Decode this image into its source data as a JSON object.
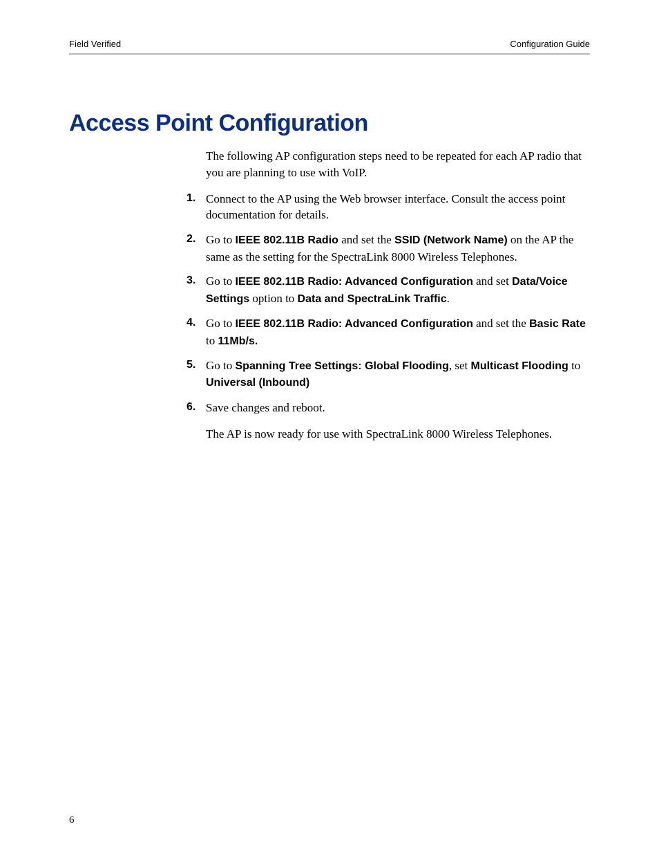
{
  "header": {
    "left": "Field Verified",
    "right": "Configuration Guide"
  },
  "title": "Access Point Configuration",
  "intro": "The following AP configuration steps need to be repeated for each AP radio that you are planning to use with VoIP.",
  "steps": {
    "s1": "Connect to the AP using the Web browser interface. Consult the access point documentation for details.",
    "s2": {
      "p1": "Go to ",
      "b1": "IEEE 802.11B Radio",
      "p2": " and set the ",
      "b2": "SSID (Network Name)",
      "p3": " on the AP the same as the setting for the SpectraLink 8000 Wireless Telephones."
    },
    "s3": {
      "p1": "Go to ",
      "b1": "IEEE 802.11B Radio: Advanced Configuration",
      "p2": " and set ",
      "b2": "Data/Voice Settings",
      "p3": " option to ",
      "b3": "Data and SpectraLink Traffic",
      "p4": "."
    },
    "s4": {
      "p1": "Go to ",
      "b1": "IEEE 802.11B Radio: Advanced Configuration",
      "p2": " and set the ",
      "b2": "Basic Rate",
      "p3": " to ",
      "b3": "11Mb/s."
    },
    "s5": {
      "p1": "Go to ",
      "b1": "Spanning Tree Settings: Global Flooding",
      "p2": ", set ",
      "b2": "Multicast Flooding",
      "p3": " to ",
      "b3": "Universal (Inbound)"
    },
    "s6": "Save changes and reboot."
  },
  "closing": "The AP is now ready for use with SpectraLink 8000 Wireless Telephones.",
  "pageNumber": "6"
}
